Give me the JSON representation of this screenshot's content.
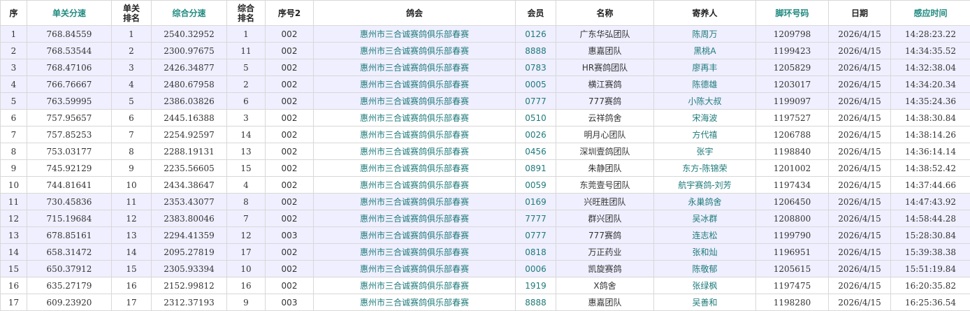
{
  "table": {
    "headers": [
      "序",
      "单关分速",
      "单关\n排名",
      "综合分速",
      "综合\n排名",
      "序号2",
      "鸽会",
      "会员",
      "名称",
      "寄养人",
      "脚环号码",
      "日期",
      "感应时间"
    ],
    "rows": [
      {
        "idx": "1",
        "speed1": "768.84559",
        "rank1": "1",
        "speed2": "2540.32952",
        "rank2": "1",
        "seq2": "002",
        "club": "惠州市三合诚赛鸽俱乐部春赛",
        "member": "0126",
        "name": "广东华弘团队",
        "fosterer": "陈周万",
        "ring": "1209798",
        "date": "2026/4/15",
        "time": "14:28:23.22",
        "highlight": true
      },
      {
        "idx": "2",
        "speed1": "768.53544",
        "rank1": "2",
        "speed2": "2300.97675",
        "rank2": "11",
        "seq2": "002",
        "club": "惠州市三合诚赛鸽俱乐部春赛",
        "member": "8888",
        "name": "惠嘉团队",
        "fosterer": "黑桃A",
        "ring": "1199423",
        "date": "2026/4/15",
        "time": "14:34:35.52",
        "highlight": true
      },
      {
        "idx": "3",
        "speed1": "768.47106",
        "rank1": "3",
        "speed2": "2426.34877",
        "rank2": "5",
        "seq2": "002",
        "club": "惠州市三合诚赛鸽俱乐部春赛",
        "member": "0783",
        "name": "HR赛鸽团队",
        "fosterer": "廖再丰",
        "ring": "1205829",
        "date": "2026/4/15",
        "time": "14:32:38.04",
        "highlight": true
      },
      {
        "idx": "4",
        "speed1": "766.76667",
        "rank1": "4",
        "speed2": "2480.67958",
        "rank2": "2",
        "seq2": "002",
        "club": "惠州市三合诚赛鸽俱乐部春赛",
        "member": "0005",
        "name": "横江赛鸽",
        "fosterer": "陈德雄",
        "ring": "1203017",
        "date": "2026/4/15",
        "time": "14:34:20.34",
        "highlight": true
      },
      {
        "idx": "5",
        "speed1": "763.59995",
        "rank1": "5",
        "speed2": "2386.03826",
        "rank2": "6",
        "seq2": "002",
        "club": "惠州市三合诚赛鸽俱乐部春赛",
        "member": "0777",
        "name": "777赛鸽",
        "fosterer": "小陈大叔",
        "ring": "1199097",
        "date": "2026/4/15",
        "time": "14:35:24.36",
        "highlight": true
      },
      {
        "idx": "6",
        "speed1": "757.95657",
        "rank1": "6",
        "speed2": "2445.16388",
        "rank2": "3",
        "seq2": "002",
        "club": "惠州市三合诚赛鸽俱乐部春赛",
        "member": "0510",
        "name": "云祥鸽舍",
        "fosterer": "宋海波",
        "ring": "1197527",
        "date": "2026/4/15",
        "time": "14:38:30.84",
        "highlight": false
      },
      {
        "idx": "7",
        "speed1": "757.85253",
        "rank1": "7",
        "speed2": "2254.92597",
        "rank2": "14",
        "seq2": "002",
        "club": "惠州市三合诚赛鸽俱乐部春赛",
        "member": "0026",
        "name": "明月心团队",
        "fosterer": "方代禧",
        "ring": "1206788",
        "date": "2026/4/15",
        "time": "14:38:14.26",
        "highlight": false
      },
      {
        "idx": "8",
        "speed1": "753.03177",
        "rank1": "8",
        "speed2": "2288.19131",
        "rank2": "13",
        "seq2": "002",
        "club": "惠州市三合诚赛鸽俱乐部春赛",
        "member": "0456",
        "name": "深圳壹鸽团队",
        "fosterer": "张宇",
        "ring": "1198840",
        "date": "2026/4/15",
        "time": "14:36:14.14",
        "highlight": false
      },
      {
        "idx": "9",
        "speed1": "745.92129",
        "rank1": "9",
        "speed2": "2235.56605",
        "rank2": "15",
        "seq2": "002",
        "club": "惠州市三合诚赛鸽俱乐部春赛",
        "member": "0891",
        "name": "朱静团队",
        "fosterer": "东方-陈锦荣",
        "ring": "1201002",
        "date": "2026/4/15",
        "time": "14:38:52.42",
        "highlight": false
      },
      {
        "idx": "10",
        "speed1": "744.81641",
        "rank1": "10",
        "speed2": "2434.38647",
        "rank2": "4",
        "seq2": "002",
        "club": "惠州市三合诚赛鸽俱乐部春赛",
        "member": "0059",
        "name": "东莞壹号团队",
        "fosterer": "航宇赛鸽-刘芳",
        "ring": "1197434",
        "date": "2026/4/15",
        "time": "14:37:44.66",
        "highlight": false
      },
      {
        "idx": "11",
        "speed1": "730.45836",
        "rank1": "11",
        "speed2": "2353.43077",
        "rank2": "8",
        "seq2": "002",
        "club": "惠州市三合诚赛鸽俱乐部春赛",
        "member": "0169",
        "name": "兴旺胜团队",
        "fosterer": "永巢鸽舍",
        "ring": "1206450",
        "date": "2026/4/15",
        "time": "14:47:43.92",
        "highlight": true
      },
      {
        "idx": "12",
        "speed1": "715.19684",
        "rank1": "12",
        "speed2": "2383.80046",
        "rank2": "7",
        "seq2": "002",
        "club": "惠州市三合诚赛鸽俱乐部春赛",
        "member": "7777",
        "name": "群兴团队",
        "fosterer": "吴冰群",
        "ring": "1208800",
        "date": "2026/4/15",
        "time": "14:58:44.28",
        "highlight": true
      },
      {
        "idx": "13",
        "speed1": "678.85161",
        "rank1": "13",
        "speed2": "2294.41359",
        "rank2": "12",
        "seq2": "003",
        "club": "惠州市三合诚赛鸽俱乐部春赛",
        "member": "0777",
        "name": "777赛鸽",
        "fosterer": "连志松",
        "ring": "1199790",
        "date": "2026/4/15",
        "time": "15:28:30.84",
        "highlight": true
      },
      {
        "idx": "14",
        "speed1": "658.31472",
        "rank1": "14",
        "speed2": "2095.27819",
        "rank2": "17",
        "seq2": "002",
        "club": "惠州市三合诚赛鸽俱乐部春赛",
        "member": "0818",
        "name": "万正药业",
        "fosterer": "张和灿",
        "ring": "1196951",
        "date": "2026/4/15",
        "time": "15:39:38.38",
        "highlight": true
      },
      {
        "idx": "15",
        "speed1": "650.37912",
        "rank1": "15",
        "speed2": "2305.93394",
        "rank2": "10",
        "seq2": "002",
        "club": "惠州市三合诚赛鸽俱乐部春赛",
        "member": "0006",
        "name": "凯旋赛鸽",
        "fosterer": "陈敬郁",
        "ring": "1205615",
        "date": "2026/4/15",
        "time": "15:51:19.84",
        "highlight": true
      },
      {
        "idx": "16",
        "speed1": "635.27179",
        "rank1": "16",
        "speed2": "2152.99812",
        "rank2": "16",
        "seq2": "002",
        "club": "惠州市三合诚赛鸽俱乐部春赛",
        "member": "1919",
        "name": "X鸽舍",
        "fosterer": "张绿枫",
        "ring": "1197475",
        "date": "2026/4/15",
        "time": "16:20:35.82",
        "highlight": false
      },
      {
        "idx": "17",
        "speed1": "609.23920",
        "rank1": "17",
        "speed2": "2312.37193",
        "rank2": "9",
        "seq2": "003",
        "club": "惠州市三合诚赛鸽俱乐部春赛",
        "member": "8888",
        "name": "惠嘉团队",
        "fosterer": "吴善和",
        "ring": "1198280",
        "date": "2026/4/15",
        "time": "16:25:36.54",
        "highlight": false
      }
    ]
  }
}
